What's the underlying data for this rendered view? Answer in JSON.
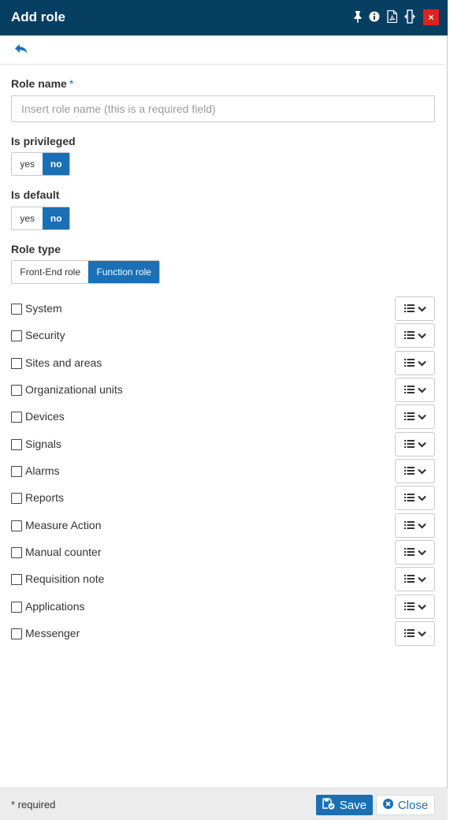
{
  "window": {
    "title": "Add role",
    "icons": [
      "pin-icon",
      "info-icon",
      "pdf-icon",
      "resize-icon",
      "close-icon"
    ],
    "close_glyph": "×"
  },
  "form": {
    "role_name": {
      "label": "Role name",
      "required_mark": "*",
      "value": "",
      "placeholder": "Insert role name (this is a required field)"
    },
    "is_privileged": {
      "label": "Is privileged",
      "options": [
        "yes",
        "no"
      ],
      "selected": "no"
    },
    "is_default": {
      "label": "Is default",
      "options": [
        "yes",
        "no"
      ],
      "selected": "no"
    },
    "role_type": {
      "label": "Role type",
      "options": [
        "Front-End role",
        "Function role"
      ],
      "selected": "Function role"
    },
    "permissions": [
      {
        "label": "System",
        "checked": false
      },
      {
        "label": "Security",
        "checked": false
      },
      {
        "label": "Sites and areas",
        "checked": false
      },
      {
        "label": "Organizational units",
        "checked": false
      },
      {
        "label": "Devices",
        "checked": false
      },
      {
        "label": "Signals",
        "checked": false
      },
      {
        "label": "Alarms",
        "checked": false
      },
      {
        "label": "Reports",
        "checked": false
      },
      {
        "label": "Measure Action",
        "checked": false
      },
      {
        "label": "Manual counter",
        "checked": false
      },
      {
        "label": "Requisition note",
        "checked": false
      },
      {
        "label": "Applications",
        "checked": false
      },
      {
        "label": "Messenger",
        "checked": false
      }
    ]
  },
  "footer": {
    "required_note": "* required",
    "save_label": "Save",
    "close_label": "Close"
  },
  "colors": {
    "titlebar": "#073f63",
    "accent": "#1a6fb5",
    "close_button": "#d9261c",
    "footer_bg": "#ececec"
  }
}
